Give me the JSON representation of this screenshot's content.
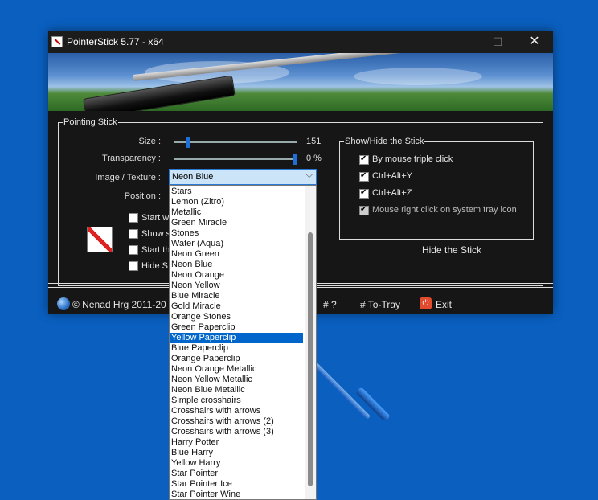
{
  "window": {
    "title": "PointerStick 5.77 - x64",
    "minimize_glyph": "—",
    "maximize_glyph": "☐",
    "close_glyph": "✕"
  },
  "pointing_stick": {
    "legend": "Pointing Stick",
    "size_label": "Size :",
    "size_value": "151",
    "size_level": 0.1,
    "transparency_label": "Transparency :",
    "transparency_value": "0 %",
    "transparency_level": 1.0,
    "image_label": "Image / Texture :",
    "image_selected": "Neon Blue",
    "position_label": "Position :",
    "checkboxes": [
      "Start wi",
      "Show s",
      "Start th",
      "Hide S"
    ]
  },
  "show_hide": {
    "legend": "Show/Hide the Stick",
    "options": [
      {
        "label": "By mouse triple click",
        "checked": true,
        "enabled": true
      },
      {
        "label": "Ctrl+Alt+Y",
        "checked": true,
        "enabled": true
      },
      {
        "label": "Ctrl+Alt+Z",
        "checked": true,
        "enabled": true
      },
      {
        "label": "Mouse right click on system tray icon",
        "checked": true,
        "enabled": false
      }
    ],
    "hide_button": "Hide the Stick"
  },
  "footer": {
    "copyright": "© Nenad Hrg 2011-20",
    "help": "# ?",
    "to_tray": "# To-Tray",
    "exit": "Exit"
  },
  "dropdown": {
    "items": [
      "Stars",
      "Lemon (Zitro)",
      "Metallic",
      "Green Miracle",
      "Stones",
      "Water (Aqua)",
      "Neon Green",
      "Neon Blue",
      "Neon Orange",
      "Neon Yellow",
      "Blue Miracle",
      "Gold Miracle",
      "Orange Stones",
      "Green Paperclip",
      "Yellow Paperclip",
      "Blue Paperclip",
      "Orange Paperclip",
      "Neon Orange Metallic",
      "Neon Yellow Metallic",
      "Neon Blue Metallic",
      "Simple crosshairs",
      "Crosshairs with arrows",
      "Crosshairs with arrows (2)",
      "Crosshairs with arrows (3)",
      "Harry Potter",
      "Blue Harry",
      "Yellow Harry",
      "Star Pointer",
      "Star Pointer Ice",
      "Star Pointer Wine"
    ],
    "selected_index": 14
  },
  "colors": {
    "desktop": "#0a5fbf",
    "window": "#161616",
    "accent": "#0066cc"
  }
}
